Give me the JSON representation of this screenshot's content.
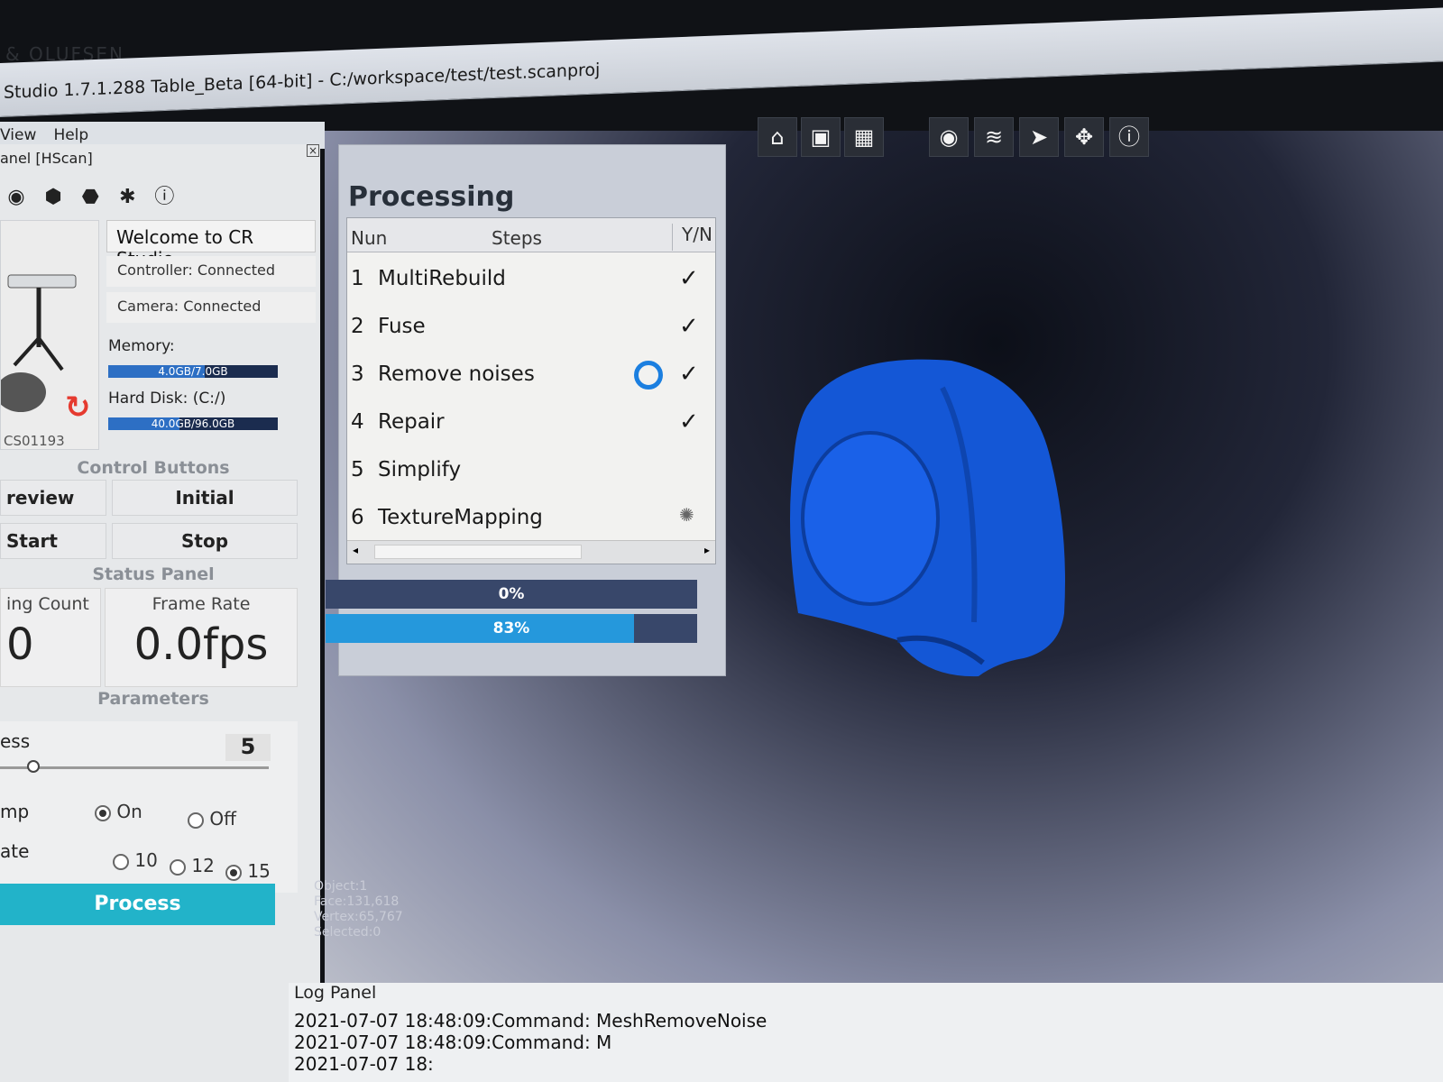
{
  "bezel": {
    "brand": "& OLUFSEN"
  },
  "window": {
    "title": "Studio 1.7.1.288 Table_Beta [64-bit] - C:/workspace/test/test.scanproj"
  },
  "menu": {
    "items": [
      "View",
      "Help"
    ]
  },
  "left_panel": {
    "title": "anel [HScan]",
    "welcome": "Welcome to CR Studio",
    "controller_status": "Controller: Connected",
    "camera_status": "Camera: Connected",
    "memory_label": "Memory:",
    "memory_value": "4.0GB/7.0GB",
    "memory_fraction": 0.57,
    "disk_label": "Hard Disk: (C:/)",
    "disk_value": "40.0GB/96.0GB",
    "disk_fraction": 0.42,
    "device_id": "CS01193",
    "control_buttons_title": "Control Buttons",
    "buttons": {
      "preview": "review",
      "initial": "Initial",
      "start": "Start",
      "stop": "Stop"
    },
    "status_panel_title": "Status Panel",
    "count_label": "ing Count",
    "count_value": "0",
    "frame_rate_label": "Frame Rate",
    "frame_rate_value": "0.0fps",
    "parameters_title": "Parameters",
    "param1_label": "ess",
    "param1_value": "5",
    "param1_level": 0.1,
    "param2_label": "mp",
    "param2_on": "On",
    "param2_off": "Off",
    "param3_label": "ate",
    "param3_options": [
      "10",
      "12",
      "15"
    ],
    "process_button": "Process"
  },
  "processing": {
    "title": "Processing",
    "columns": [
      "Nun",
      "Steps",
      "Y/N"
    ],
    "rows": [
      {
        "num": "1",
        "step": "MultiRebuild",
        "check": "✓"
      },
      {
        "num": "2",
        "step": "Fuse",
        "check": "✓"
      },
      {
        "num": "3",
        "step": "Remove noises",
        "check": "✓"
      },
      {
        "num": "4",
        "step": "Repair",
        "check": "✓"
      },
      {
        "num": "5",
        "step": "Simplify",
        "check": ""
      },
      {
        "num": "6",
        "step": "TextureMapping",
        "check": ""
      }
    ],
    "progress1_label": "0%",
    "progress1": 0,
    "progress2_label": "83%",
    "progress2": 0.83
  },
  "viewport": {
    "stats": [
      "Object:1",
      "Face:131,618",
      "Vertex:65,767",
      "Selected:0"
    ]
  },
  "toolbar": {
    "icons": [
      "home-icon",
      "fit-view-icon",
      "texture-icon",
      "eye-icon",
      "layers-icon",
      "pointer-icon",
      "move-icon",
      "info-icon"
    ]
  },
  "log": {
    "title": "Log Panel",
    "lines": [
      "2021-07-07 18:48:09:Command: MeshRemoveNoise",
      "2021-07-07 18:48:09:Command: M",
      "2021-07-07 18:"
    ]
  },
  "colors": {
    "accent": "#22b3c9",
    "progress": "#2598dc",
    "mesh": "#1457d6"
  }
}
